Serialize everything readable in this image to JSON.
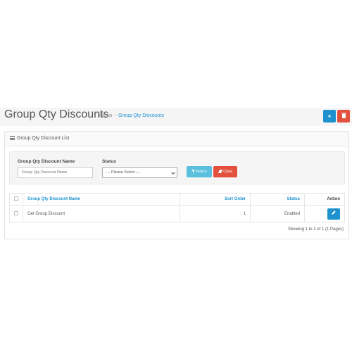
{
  "header": {
    "title": "Group Qty Discounts",
    "breadcrumb": [
      "Home",
      "Group Qty Discounts"
    ],
    "add_icon": "plus-icon",
    "delete_icon": "trash-icon",
    "add_glyph": "+",
    "delete_glyph": "🗑"
  },
  "panel": {
    "title": "Group Qty Discount List",
    "icon": "list-icon"
  },
  "filter": {
    "name_label": "Group Qty Discount Name",
    "name_placeholder": "Group Qty Discount Name",
    "name_value": "",
    "status_label": "Status",
    "status_selected": "--- Please Select ---",
    "filter_button": "Filters",
    "clear_button": "Clear",
    "filter_icon": "funnel-icon",
    "clear_icon": "eraser-icon"
  },
  "table": {
    "columns": [
      "Group Qty Discount Name",
      "Sort Order",
      "Status",
      "Action"
    ],
    "rows": [
      {
        "name": "Get Group Discount",
        "sort_order": "1",
        "status": "Enabled"
      }
    ]
  },
  "pagination": {
    "info": "Showing 1 to 1 of 1 (1 Pages)"
  },
  "colors": {
    "primary": "#1e91cf",
    "danger": "#e3503e",
    "info": "#5bc0de"
  }
}
